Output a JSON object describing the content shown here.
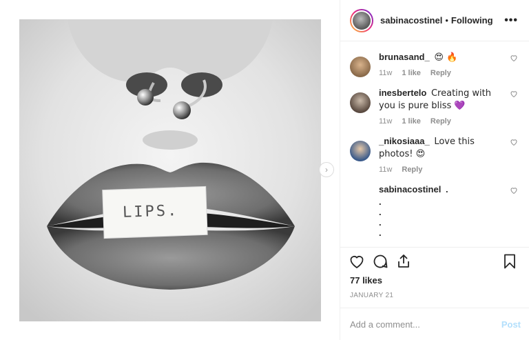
{
  "header": {
    "username": "sabinacostinel",
    "separator": "•",
    "follow_label": "Following",
    "more_label": "•••"
  },
  "media": {
    "card_text": "LIPS.",
    "next_label": "›"
  },
  "comments": [
    {
      "user": "brunasand_",
      "text": "😍 🔥",
      "age": "11w",
      "likes": "1 like",
      "reply": "Reply",
      "avatar_color": "#8a6a4a"
    },
    {
      "user": "inesbertelo",
      "text": "Creating with you is pure bliss 💜",
      "age": "11w",
      "likes": "1 like",
      "reply": "Reply",
      "avatar_color": "#5a4a40"
    },
    {
      "user": "_nikosiaaa_",
      "text": "Love this photos! 😍",
      "age": "11w",
      "likes": "",
      "reply": "Reply",
      "avatar_color": "#3a5a8a"
    }
  ],
  "caption": {
    "user": "sabinacostinel",
    "text": ".",
    "lines": [
      ".",
      ".",
      ".",
      "."
    ]
  },
  "stats": {
    "likes": "77 likes",
    "date": "JANUARY 21"
  },
  "composer": {
    "placeholder": "Add a comment...",
    "post_label": "Post"
  }
}
